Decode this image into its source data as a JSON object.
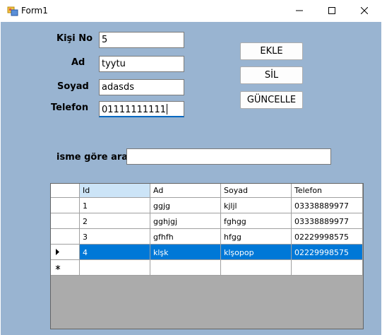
{
  "window": {
    "title": "Form1",
    "icon": "winforms-app-icon",
    "controls": [
      "minimize-icon",
      "maximize-icon",
      "close-icon"
    ]
  },
  "colors": {
    "form_background": "#99b4d1",
    "selection": "#0078d7",
    "grid_background": "#ababab",
    "sorted_header": "#cce4f7"
  },
  "form": {
    "kisi_no_label": "Kişi No",
    "kisi_no_value": "5",
    "ad_label": "Ad",
    "ad_value": "tyytu",
    "soyad_label": "Soyad",
    "soyad_value": "adasds",
    "telefon_label": "Telefon",
    "telefon_value": "01111111111",
    "search_label": "isme göre ara",
    "search_value": ""
  },
  "buttons": {
    "ekle": "EKLE",
    "sil": "SİL",
    "guncelle": "GÜNCELLE"
  },
  "grid": {
    "columns": [
      "Id",
      "Ad",
      "Soyad",
      "Telefon"
    ],
    "rows": [
      [
        "1",
        "ggjg",
        "kjljl",
        "03338889977"
      ],
      [
        "2",
        "gghjgj",
        "fghgg",
        "03338889977"
      ],
      [
        "3",
        "gfhfh",
        "hfgg",
        "02229998575"
      ],
      [
        "4",
        "klşk",
        "klşopop",
        "02229998575"
      ]
    ],
    "current_row_icon": "current-row-arrow-icon",
    "new_row_icon": "new-row-asterisk-icon"
  }
}
